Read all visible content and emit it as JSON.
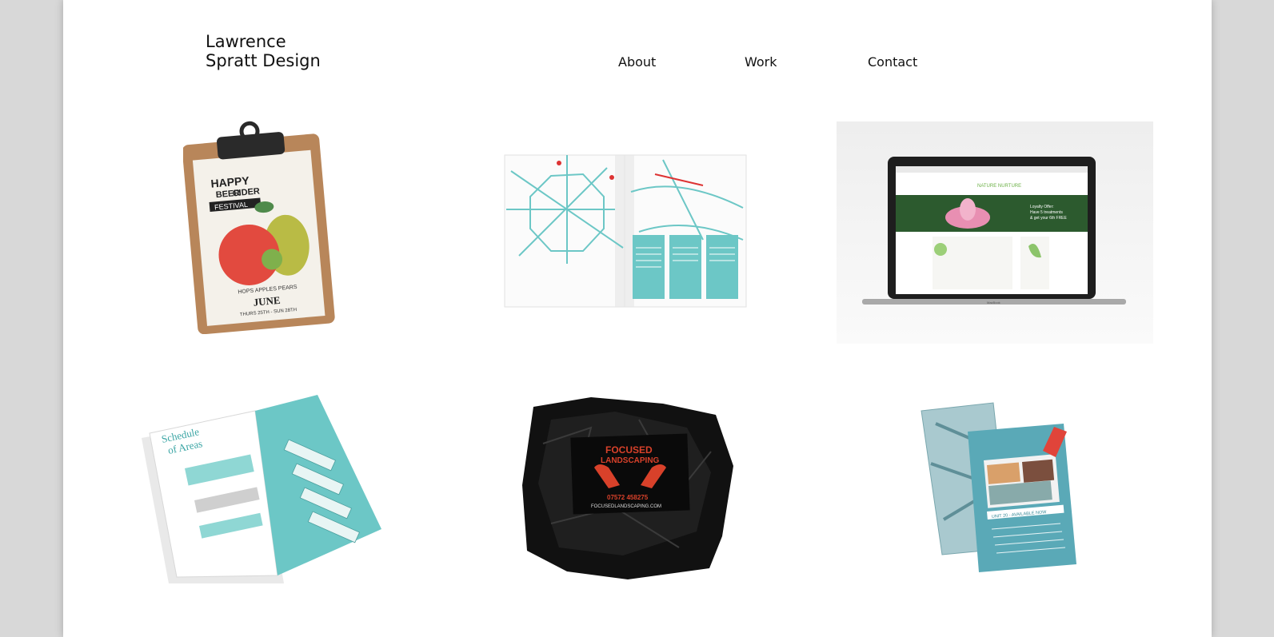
{
  "site": {
    "logo_line1": "Lawrence",
    "logo_line2": "Spratt Design"
  },
  "nav": {
    "about": "About",
    "work": "Work",
    "contact": "Contact"
  },
  "work": [
    {
      "poster_line1": "HAPPY",
      "poster_line2": "BEER",
      "poster_line3": "CIDER",
      "poster_banner": "FESTIVAL",
      "poster_tagline": "HOPS APPLES PEARS",
      "poster_month": "JUNE",
      "poster_dates": "THURS 25TH - SUN 28TH"
    },
    {},
    {
      "site_brand": "NATURE NURTURE",
      "site_offer_line1": "Loyalty Offer:",
      "site_offer_line2": "Have 5 treatments",
      "site_offer_line3": "& get your 6th FREE",
      "laptop_label": "MacBook"
    },
    {
      "brochure_heading_line1": "Schedule",
      "brochure_heading_line2": "of Areas"
    },
    {
      "card_title_line1": "FOCUSED",
      "card_title_line2": "LANDSCAPING",
      "card_phone": "07572 458275",
      "card_url": "FOCUSEDLANDSCAPING.COM"
    },
    {
      "flyer_banner": "UNIT 20 - AVAILABLE NOW"
    }
  ],
  "colors": {
    "teal": "#6cc7c6",
    "card_red": "#d8412a",
    "apple_red": "#e24a3f",
    "pear_green": "#b9bb45",
    "clipboard": "#b8865a"
  }
}
